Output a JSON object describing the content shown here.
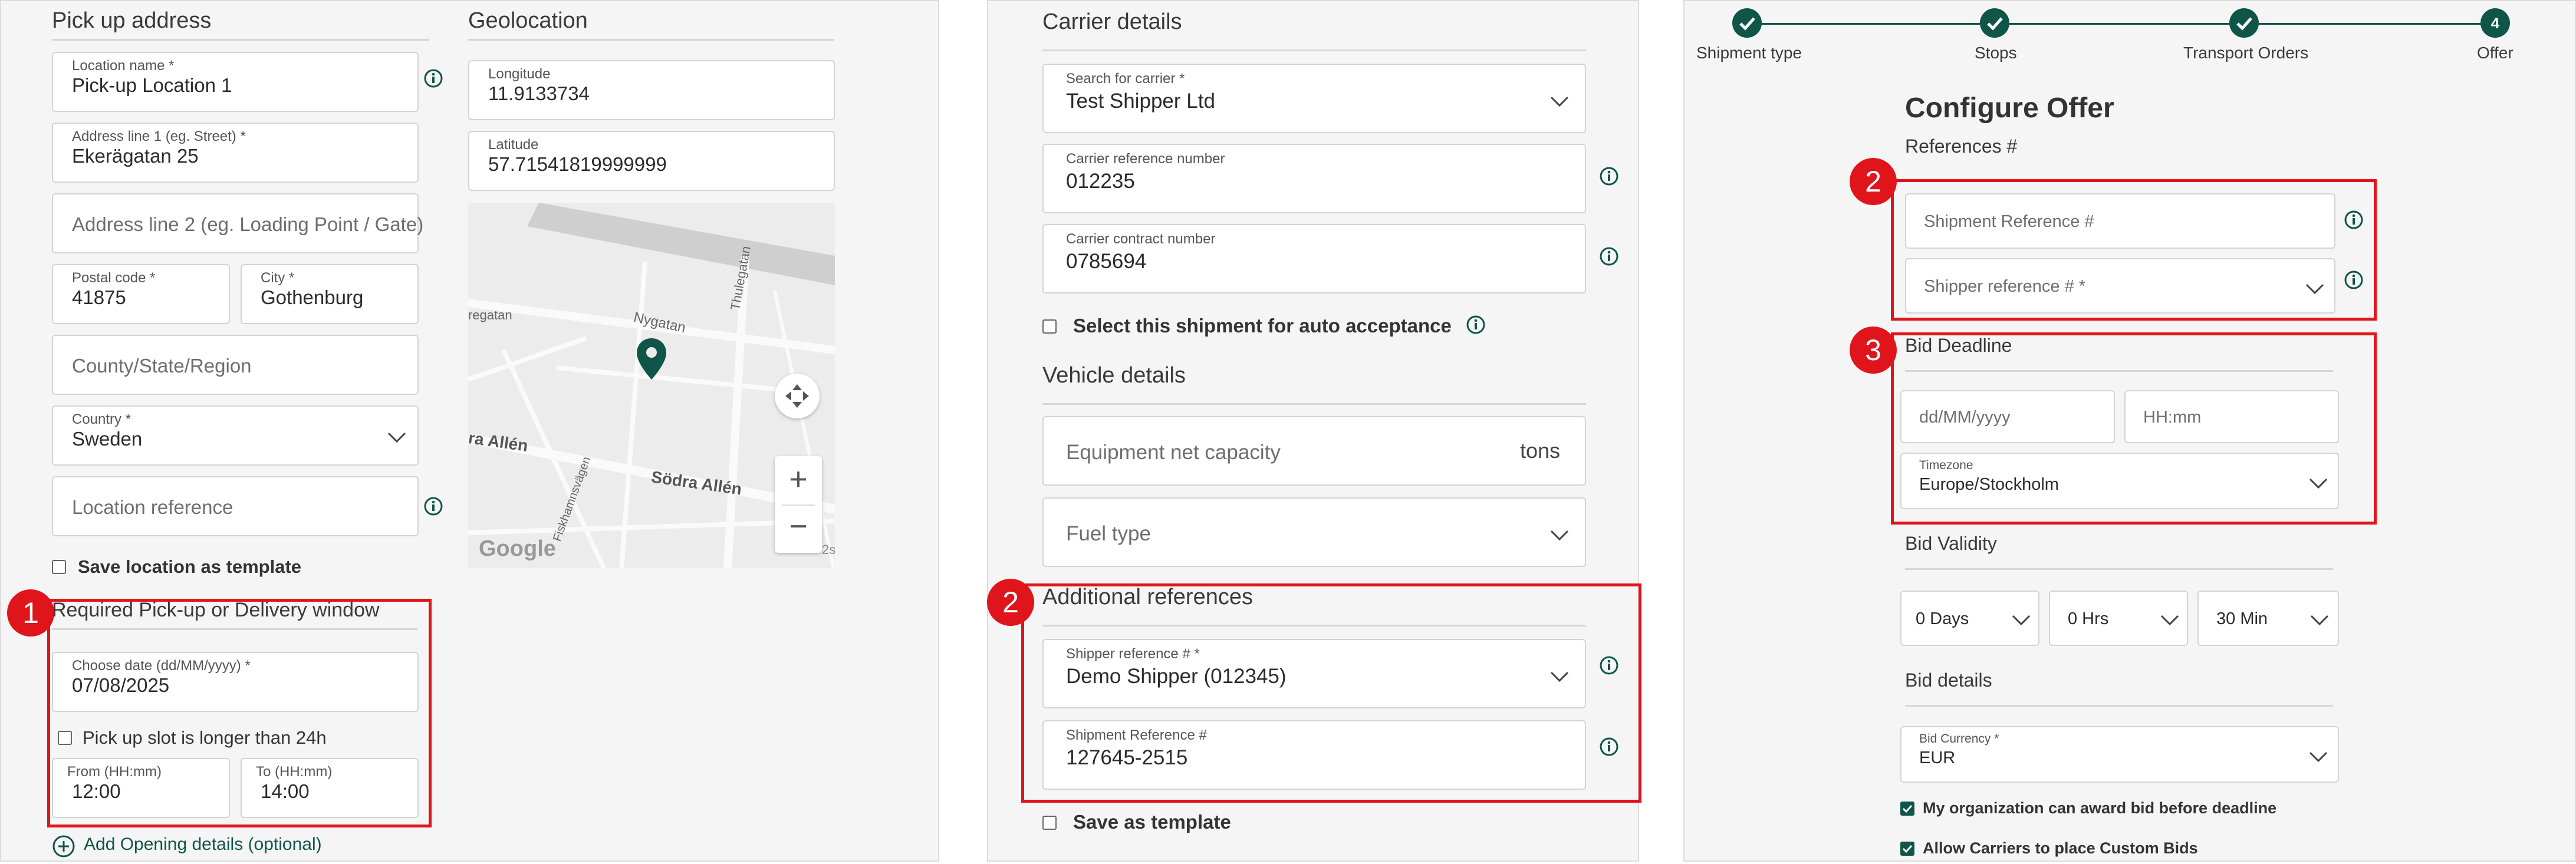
{
  "panel1": {
    "pickup_title": "Pick up address",
    "geo_title": "Geolocation",
    "location_name": {
      "label": "Location name *",
      "value": "Pick-up Location 1"
    },
    "address1": {
      "label": "Address line 1 (eg. Street) *",
      "value": "Ekerägatan 25"
    },
    "address2": {
      "placeholder": "Address line 2 (eg. Loading Point / Gate)"
    },
    "postal": {
      "label": "Postal code *",
      "value": "41875"
    },
    "city": {
      "label": "City *",
      "value": "Gothenburg"
    },
    "county": {
      "placeholder": "County/State/Region"
    },
    "country": {
      "label": "Country *",
      "value": "Sweden"
    },
    "location_ref": {
      "placeholder": "Location reference"
    },
    "save_template": "Save location as template",
    "longitude": {
      "label": "Longitude",
      "value": "11.9133734"
    },
    "latitude": {
      "label": "Latitude",
      "value": "57.71541819999999"
    },
    "map": {
      "street1": "Nygatan",
      "street2": "Thulegatan",
      "street3": "Södra Allén",
      "street4": "ra Allén",
      "street5": "regatan",
      "street6": "Fiskhamnsvägen",
      "logo": "Google",
      "zoom_in": "+",
      "zoom_out": "−",
      "edge_mark": "2s"
    },
    "window_title": "Required Pick-up or Delivery window",
    "date": {
      "label": "Choose date (dd/MM/yyyy) *",
      "value": "07/08/2025"
    },
    "slot_longer": "Pick up slot is longer than 24h",
    "from": {
      "label": "From (HH:mm)",
      "value": "12:00"
    },
    "to": {
      "label": "To (HH:mm)",
      "value": "14:00"
    },
    "add_opening": "Add Opening details (optional)",
    "badge": "1"
  },
  "panel2": {
    "carrier_title": "Carrier details",
    "search_carrier": {
      "label": "Search for carrier *",
      "value": "Test Shipper Ltd"
    },
    "carrier_ref": {
      "label": "Carrier reference number",
      "value": "012235"
    },
    "carrier_contract": {
      "label": "Carrier contract number",
      "value": "0785694"
    },
    "auto_accept": "Select this shipment for auto acceptance",
    "vehicle_title": "Vehicle details",
    "equipment": {
      "placeholder": "Equipment net capacity",
      "unit": "tons"
    },
    "fuel": {
      "placeholder": "Fuel type"
    },
    "additional_title": "Additional references",
    "shipper_ref": {
      "label": "Shipper reference # *",
      "value": "Demo Shipper (012345)"
    },
    "shipment_ref": {
      "label": "Shipment Reference #",
      "value": "127645-2515"
    },
    "save_template": "Save as template",
    "badge": "2"
  },
  "panel3": {
    "steps": [
      {
        "label": "Shipment type",
        "state": "done"
      },
      {
        "label": "Stops",
        "state": "done"
      },
      {
        "label": "Transport Orders",
        "state": "done"
      },
      {
        "label": "Offer",
        "number": "4",
        "state": "current"
      }
    ],
    "title": "Configure Offer",
    "refs_title": "References #",
    "shipment_ref": {
      "placeholder": "Shipment Reference #"
    },
    "shipper_ref": {
      "placeholder": "Shipper reference # *"
    },
    "deadline_title": "Bid Deadline",
    "date": {
      "placeholder": "dd/MM/yyyy"
    },
    "time": {
      "placeholder": "HH:mm"
    },
    "timezone": {
      "label": "Timezone",
      "value": "Europe/Stockholm"
    },
    "validity_title": "Bid Validity",
    "days": "0 Days",
    "hrs": "0 Hrs",
    "mins": "30 Min",
    "details_title": "Bid details",
    "currency": {
      "label": "Bid Currency *",
      "value": "EUR"
    },
    "award_before": "My organization can award bid before deadline",
    "custom_bids": "Allow Carriers to place Custom Bids",
    "badge2": "2",
    "badge3": "3"
  },
  "colors": {
    "accent": "#0f5548",
    "highlight": "#e0141b"
  }
}
